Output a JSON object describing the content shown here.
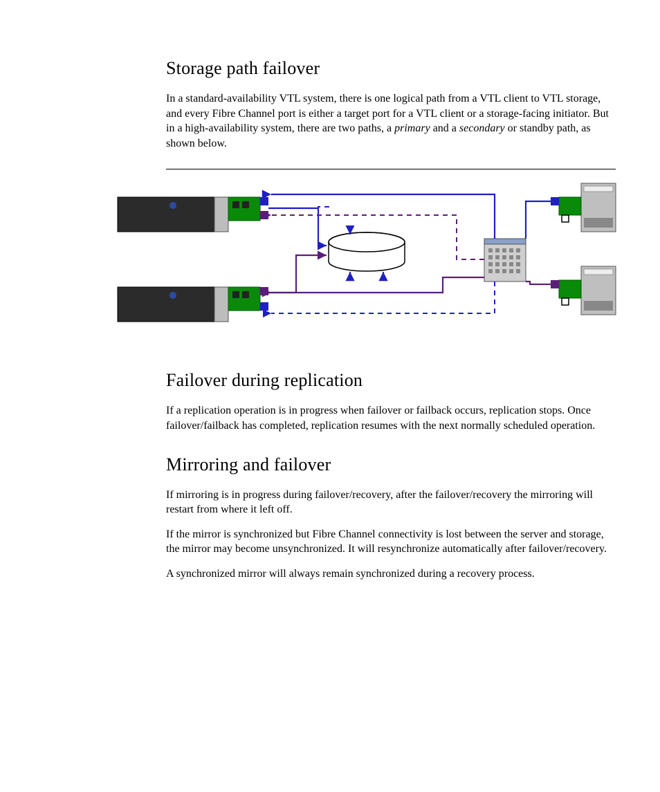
{
  "sections": {
    "s1": {
      "heading": "Storage path failover",
      "para1_pre": "In a standard-availability VTL system, there is one logical path from a VTL client to VTL storage, and every Fibre Channel port is either a target port for a VTL client or a storage-facing initiator. But in a high-availability system, there are two paths, a ",
      "para1_em1": "primary",
      "para1_mid": " and a ",
      "para1_em2": "secondary",
      "para1_post": " or standby path, as shown below."
    },
    "s2": {
      "heading": "Failover during replication",
      "para1": "If a replication operation is in progress when failover or failback occurs, replication stops. Once failover/failback has completed, replication resumes with the next normally scheduled operation."
    },
    "s3": {
      "heading": "Mirroring and failover",
      "para1": "If mirroring is in progress during failover/recovery, after the failover/recovery the mirroring will restart from where it left off.",
      "para2": "If the mirror is synchronized but Fibre Channel connectivity is lost between the server and storage, the mirror may become unsynchronized. It will resynchronize automatically after failover/recovery.",
      "para3": "A synchronized mirror will always remain synchronized during a recovery process."
    }
  },
  "diagram": {
    "labels": {
      "vtl_server_top": "vtl-server-primary",
      "vtl_server_bottom": "vtl-server-secondary",
      "storage": "storage-cylinder",
      "switch": "fc-switch",
      "client_top": "client-top",
      "client_bottom": "client-bottom"
    },
    "paths": {
      "primary_color": "#2020c0",
      "secondary_color": "#5a1e78"
    }
  }
}
